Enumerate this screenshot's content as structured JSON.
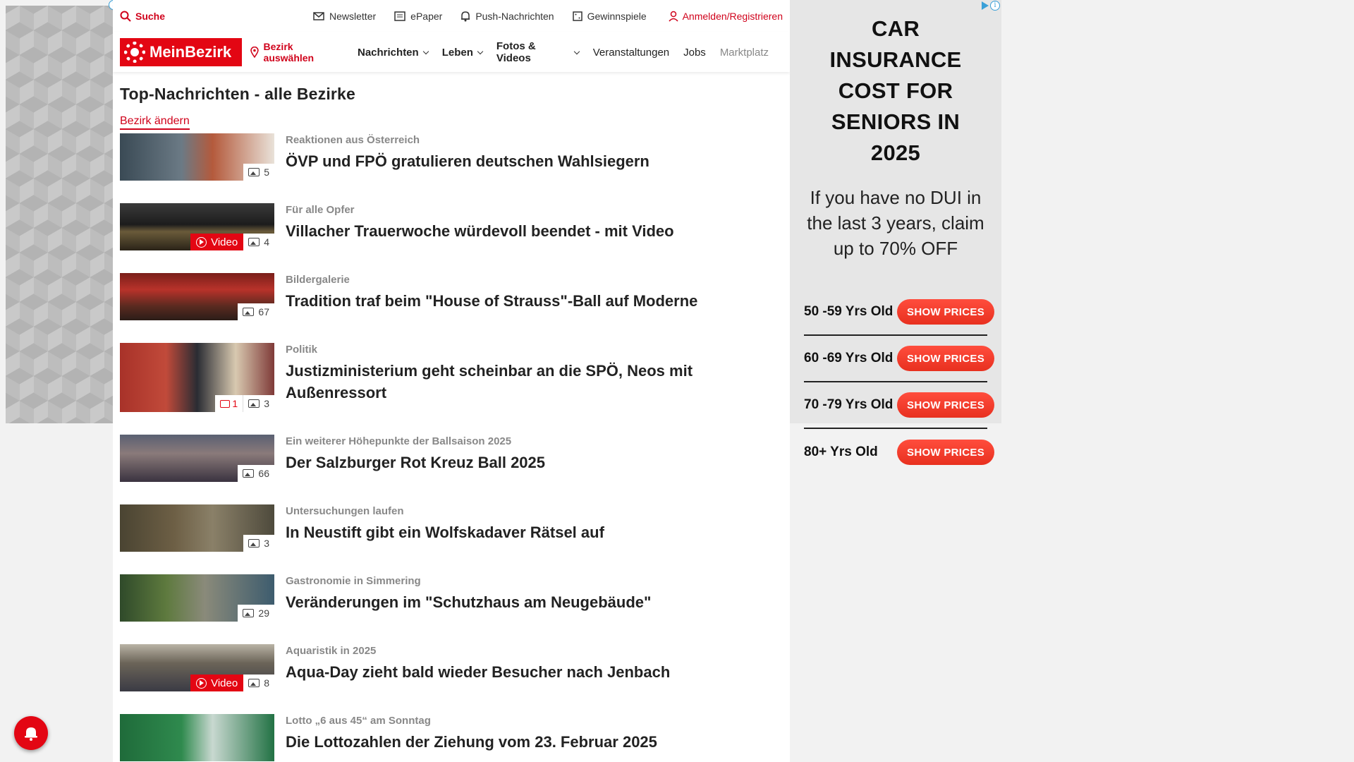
{
  "topbar": {
    "search": "Suche",
    "links": [
      "Newsletter",
      "ePaper",
      "Push-Nachrichten",
      "Gewinnspiele"
    ],
    "login": "Anmelden/Registrieren"
  },
  "nav": {
    "logo": "MeinBezirk",
    "bezirk": "Bezirk auswählen",
    "items": [
      "Nachrichten",
      "Leben",
      "Fotos & Videos",
      "Veranstaltungen",
      "Jobs",
      "Marktplatz"
    ]
  },
  "page": {
    "title": "Top-Nachrichten - alle Bezirke",
    "change_link": "Bezirk ändern"
  },
  "articles": [
    {
      "kicker": "Reaktionen aus Österreich",
      "headline": "ÖVP und FPÖ gratulieren deutschen Wahlsiegern",
      "images": "5",
      "video": "",
      "comments": "",
      "bg": "linear-gradient(90deg,#3a4a55 0%,#6b7a85 40%,#b45a3c 60%,#e9e2d9 100%)"
    },
    {
      "kicker": "Für alle Opfer",
      "headline": "Villacher Trauerwoche würdevoll beendet - mit Video",
      "images": "4",
      "video": "Video",
      "comments": "",
      "bg": "linear-gradient(180deg,#3b3b3b 0%,#1c1c1c 45%,#6a5b3a 60%,#2a2318 100%)"
    },
    {
      "kicker": "Bildergalerie",
      "headline": "Tradition traf beim \"House of Strauss\"-Ball auf Moderne",
      "images": "67",
      "video": "",
      "comments": "",
      "bg": "linear-gradient(180deg,#7a1f1a 0%,#b8322a 35%,#5a2a20 70%,#2b1d18 100%)"
    },
    {
      "kicker": "Politik",
      "headline": "Justizministerium geht scheinbar an die SPÖ, Neos mit Außenressort",
      "images": "3",
      "video": "",
      "comments": "1",
      "bg": "linear-gradient(90deg,#a83229 0%,#c14a3a 30%,#2a2c33 50%,#d8c9b0 75%,#7f3a38 100%)"
    },
    {
      "kicker": "Ein weiterer Höhepunkte der Ballsaison 2025",
      "headline": "Der Salzburger Rot Kreuz Ball 2025",
      "images": "66",
      "video": "",
      "comments": "",
      "bg": "linear-gradient(180deg,#5a6072 0%,#8a7a7a 40%,#3a3340 100%)"
    },
    {
      "kicker": "Untersuchungen laufen",
      "headline": "In Neustift gibt ein Wolfskadaver Rätsel auf",
      "images": "3",
      "video": "",
      "comments": "",
      "bg": "linear-gradient(90deg,#4a4432 0%,#6d5f45 35%,#8a8068 60%,#4e4a3c 100%)"
    },
    {
      "kicker": "Gastronomie in Simmering",
      "headline": "Veränderungen im \"Schutzhaus am Neugebäude\"",
      "images": "29",
      "video": "",
      "comments": "",
      "bg": "linear-gradient(90deg,#2f4a2a 0%,#5e7a3e 30%,#8a8a7a 55%,#3d5c6e 100%)"
    },
    {
      "kicker": "Aquaristik in 2025",
      "headline": "Aqua-Day zieht bald wieder Besucher nach Jenbach",
      "images": "8",
      "video": "Video",
      "comments": "",
      "bg": "linear-gradient(180deg,#b9b3a5 0%,#6b6458 40%,#3a3a44 100%)"
    },
    {
      "kicker": "Lotto „6 aus 45“ am Sonntag",
      "headline": "Die Lottozahlen der Ziehung vom 23. Februar 2025",
      "images": "",
      "video": "",
      "comments": "",
      "bg": "linear-gradient(90deg,#1f6b3a 0%,#2f8a4e 40%,#c8d8d0 60%,#227244 100%)"
    }
  ],
  "ad": {
    "headline": "CAR INSURANCE COST FOR SENIORS IN 2025",
    "sub": "If you have no DUI in the last 3 years, claim up to 70% OFF",
    "button": "SHOW PRICES",
    "rows": [
      "50 -59 Yrs Old",
      "60 -69 Yrs Old",
      "70 -79 Yrs Old",
      "80+ Yrs Old"
    ]
  },
  "colors": {
    "brand_red": "#e30613"
  }
}
